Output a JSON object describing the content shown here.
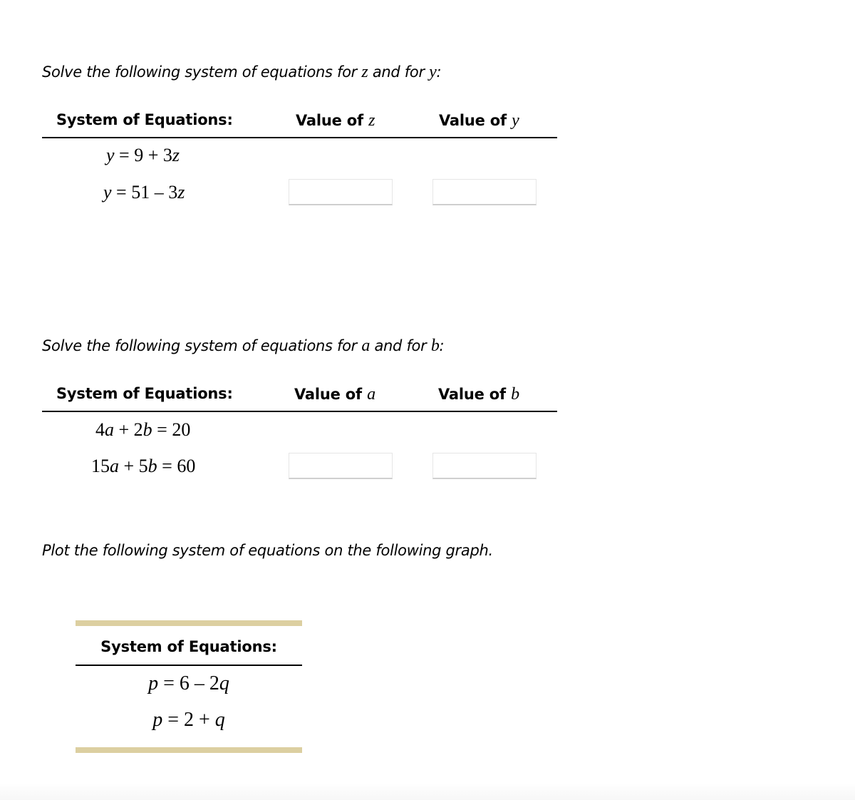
{
  "problem1": {
    "prompt_prefix": "Solve the following system of equations for ",
    "var1": "z",
    "prompt_middle": " and for ",
    "var2": "y",
    "prompt_suffix": ":",
    "header_system": "System of Equations:",
    "header_value_prefix": "Value of ",
    "header_var1": "z",
    "header_var2": "y",
    "equations": [
      {
        "lhs": "y",
        "rhs": " = 9 + 3",
        "rhs_var": "z"
      },
      {
        "lhs": "y",
        "rhs": " = 51 – 3",
        "rhs_var": "z"
      }
    ],
    "answer1_value": "",
    "answer2_value": ""
  },
  "problem2": {
    "prompt_prefix": "Solve the following system of equations for ",
    "var1": "a",
    "prompt_middle": " and for ",
    "var2": "b",
    "prompt_suffix": ":",
    "header_system": "System of Equations:",
    "header_value_prefix": "Value of ",
    "header_var1": "a",
    "header_var2": "b",
    "equations": [
      {
        "c1": "4",
        "v1": "a",
        "op": " + 2",
        "v2": "b",
        "rhs": " = 20"
      },
      {
        "c1": "15",
        "v1": "a",
        "op": " + 5",
        "v2": "b",
        "rhs": " = 60"
      }
    ],
    "answer1_value": "",
    "answer2_value": ""
  },
  "problem3": {
    "prompt": "Plot the following system of equations on the following graph.",
    "header_system": "System of Equations:",
    "equations": [
      {
        "lhs": "p",
        "rhs": " = 6 – 2",
        "rhs_var": "q"
      },
      {
        "lhs": "p",
        "rhs": " = 2 + ",
        "rhs_var": "q"
      }
    ],
    "band_color": "#dccfa1"
  }
}
